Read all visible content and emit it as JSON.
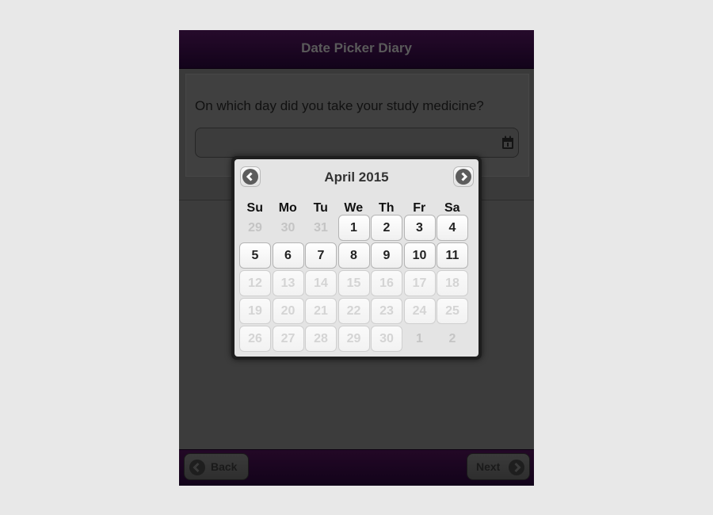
{
  "header": {
    "title": "Date Picker Diary"
  },
  "question": {
    "text": "On which day did you take your study medicine?"
  },
  "date_input": {
    "value": "",
    "icon": "calendar-icon"
  },
  "picker": {
    "month_label": "April 2015",
    "prev_icon": "chevron-left-icon",
    "next_icon": "chevron-right-icon",
    "weekdays": [
      "Su",
      "Mo",
      "Tu",
      "We",
      "Th",
      "Fr",
      "Sa"
    ],
    "weeks": [
      [
        {
          "label": "29",
          "state": "outside"
        },
        {
          "label": "30",
          "state": "outside"
        },
        {
          "label": "31",
          "state": "outside"
        },
        {
          "label": "1",
          "state": "enabled"
        },
        {
          "label": "2",
          "state": "enabled"
        },
        {
          "label": "3",
          "state": "enabled"
        },
        {
          "label": "4",
          "state": "enabled"
        }
      ],
      [
        {
          "label": "5",
          "state": "enabled"
        },
        {
          "label": "6",
          "state": "enabled"
        },
        {
          "label": "7",
          "state": "enabled"
        },
        {
          "label": "8",
          "state": "enabled"
        },
        {
          "label": "9",
          "state": "enabled"
        },
        {
          "label": "10",
          "state": "enabled"
        },
        {
          "label": "11",
          "state": "enabled"
        }
      ],
      [
        {
          "label": "12",
          "state": "disabled"
        },
        {
          "label": "13",
          "state": "disabled"
        },
        {
          "label": "14",
          "state": "disabled"
        },
        {
          "label": "15",
          "state": "disabled"
        },
        {
          "label": "16",
          "state": "disabled"
        },
        {
          "label": "17",
          "state": "disabled"
        },
        {
          "label": "18",
          "state": "disabled"
        }
      ],
      [
        {
          "label": "19",
          "state": "disabled"
        },
        {
          "label": "20",
          "state": "disabled"
        },
        {
          "label": "21",
          "state": "disabled"
        },
        {
          "label": "22",
          "state": "disabled"
        },
        {
          "label": "23",
          "state": "disabled"
        },
        {
          "label": "24",
          "state": "disabled"
        },
        {
          "label": "25",
          "state": "disabled"
        }
      ],
      [
        {
          "label": "26",
          "state": "disabled"
        },
        {
          "label": "27",
          "state": "disabled"
        },
        {
          "label": "28",
          "state": "disabled"
        },
        {
          "label": "29",
          "state": "disabled"
        },
        {
          "label": "30",
          "state": "disabled"
        },
        {
          "label": "1",
          "state": "outside"
        },
        {
          "label": "2",
          "state": "outside"
        }
      ]
    ]
  },
  "footer": {
    "back_label": "Back",
    "next_label": "Next",
    "back_icon": "arrow-left-icon",
    "next_icon": "arrow-right-icon"
  },
  "colors": {
    "header_bg": "#1a0521",
    "page_bg": "#3c3c3c",
    "picker_bg": "#e4e4e4"
  }
}
